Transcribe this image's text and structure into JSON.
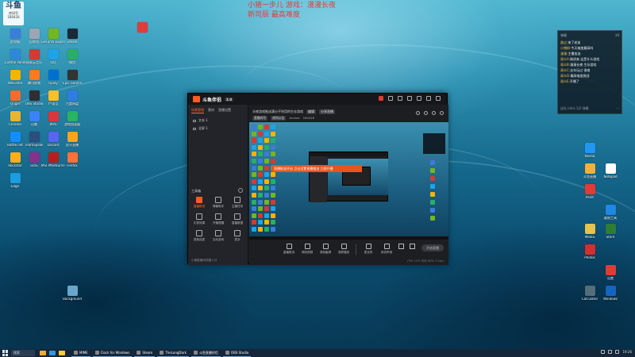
{
  "stream_overlay": {
    "line1": "小猪一步儿   游戏：漫漫长夜",
    "line2": "新司辰 最高难度"
  },
  "badge": {
    "big": "斗鱼",
    "small1": "房间号",
    "small2": "180426"
  },
  "desktop_icons_left": [
    {
      "label": "此电脑",
      "color": "#3b7dd8"
    },
    {
      "label": "回收站",
      "color": "#9aa7b3"
    },
    {
      "label": "GeForce Experience",
      "color": "#74b71b"
    },
    {
      "label": "Steam",
      "color": "#1b2838"
    },
    {
      "label": "Control Panel",
      "color": "#2f87d8"
    },
    {
      "label": "网易云音乐",
      "color": "#d33a31"
    },
    {
      "label": "QQ",
      "color": "#1fa3e8"
    },
    {
      "label": "微信",
      "color": "#2aae67"
    },
    {
      "label": "WeGame",
      "color": "#f5b400"
    },
    {
      "label": "腾讯视频",
      "color": "#ff7a1a"
    },
    {
      "label": "Uplay",
      "color": "#0070d0"
    },
    {
      "label": "Epic Games",
      "color": "#333"
    },
    {
      "label": "Origin",
      "color": "#f56c2d"
    },
    {
      "label": "OBS Studio",
      "color": "#302e31"
    },
    {
      "label": "YY语音",
      "color": "#f6c12a"
    },
    {
      "label": "百度网盘",
      "color": "#2f7de1"
    },
    {
      "label": "Chrome",
      "color": "#e9b52c"
    },
    {
      "label": "迅雷",
      "color": "#3b82f6"
    },
    {
      "label": "WPS",
      "color": "#d9363e"
    },
    {
      "label": "游戏加速器",
      "color": "#28b463"
    },
    {
      "label": "Battle.net",
      "color": "#148eff"
    },
    {
      "label": "TeamSpeak",
      "color": "#2b4e7c"
    },
    {
      "label": "Discord",
      "color": "#5865f2"
    },
    {
      "label": "虎牙直播",
      "color": "#ffa31a"
    },
    {
      "label": "Rockstar",
      "color": "#fcaf17"
    },
    {
      "label": "GOG",
      "color": "#86328a"
    },
    {
      "label": "MSI Afterburner",
      "color": "#b51f1f"
    },
    {
      "label": "Firefox",
      "color": "#ff7139"
    },
    {
      "label": "Edge",
      "color": "#1b9de2"
    },
    {
      "label": "Background",
      "color": "#6aa6cc"
    }
  ],
  "desktop_icons_right": [
    {
      "label": "Nvidia",
      "color": "#2196f3"
    },
    {
      "label": "斗鱼直播",
      "color": "#f0b13c"
    },
    {
      "label": "Notepad",
      "color": "#fff"
    },
    {
      "label": "Paint",
      "color": "#e53935"
    },
    {
      "label": "截图工具",
      "color": "#1e88e5"
    },
    {
      "label": "Media",
      "color": "#e6c34a"
    },
    {
      "label": "Store",
      "color": "#2e7d32"
    },
    {
      "label": "Photos",
      "color": "#d32f2f"
    },
    {
      "label": "设置",
      "color": "#e53935"
    },
    {
      "label": "Calculator",
      "color": "#546e7a"
    },
    {
      "label": "Windows",
      "color": "#1565c0"
    }
  ],
  "chat": {
    "title": "弹幕",
    "count": "39",
    "messages": [
      {
        "name": "路过:",
        "text": "来了老弟"
      },
      {
        "name": "小猪粉:",
        "text": "今天难度最高吗"
      },
      {
        "name": "漫漫:",
        "text": "主播加油"
      },
      {
        "name": "观众A:",
        "text": "刚进来 这是什么游戏"
      },
      {
        "name": "观众B:",
        "text": "漫漫长夜 生存游戏"
      },
      {
        "name": "观众C:",
        "text": "去年玩过 很难"
      },
      {
        "name": "观众D:",
        "text": "最高难度挑战"
      },
      {
        "name": "观众E:",
        "text": "开播了"
      }
    ],
    "footer_left": "送礼 Intro 1/2 弹幕",
    "footer_right": "···"
  },
  "app": {
    "title": "斗鱼伴侣",
    "version": "3.0",
    "sidebar_tabs": [
      "场景管理",
      "素材",
      "直播设置"
    ],
    "scenes": [
      "文本 1",
      "全屏 1"
    ],
    "tools_title": "工具箱",
    "tools": [
      {
        "label": "直播推流",
        "active": true
      },
      {
        "label": "弹幕助手",
        "active": false
      },
      {
        "label": "主播任务",
        "active": false
      },
      {
        "label": "礼物效果",
        "active": false
      },
      {
        "label": "开播提醒",
        "active": false
      },
      {
        "label": "直播数据",
        "active": false
      },
      {
        "label": "语音连麦",
        "active": false
      },
      {
        "label": "互动游戏",
        "active": false
      },
      {
        "label": "更多",
        "active": false
      }
    ],
    "sidebar_footer": "小猪直播间快捷入口",
    "room_title": "半夜游戏推送满分不利用的生存游戏",
    "room_chip1": "编辑",
    "room_chip2": "分享直播",
    "room_info": [
      "直播间号",
      "房间公告",
      "Arcane",
      "180426"
    ],
    "banner": "直播推流开启 点击设置直播推流 立即开播",
    "controls": [
      "直播推流",
      "录制视频",
      "录制截屏",
      "录屏播放",
      "麦克风",
      "系统声音"
    ],
    "go_live": "开始直播",
    "status": "CPU 12% 内存 60% 0 kb/s"
  },
  "taskbar": {
    "search": "搜索",
    "tasks": [
      "MIME",
      "Clock for Windows",
      "Steam",
      "TheLongDark",
      "斗鱼直播伴侣",
      "OBS Studio"
    ],
    "time": "19:26"
  }
}
